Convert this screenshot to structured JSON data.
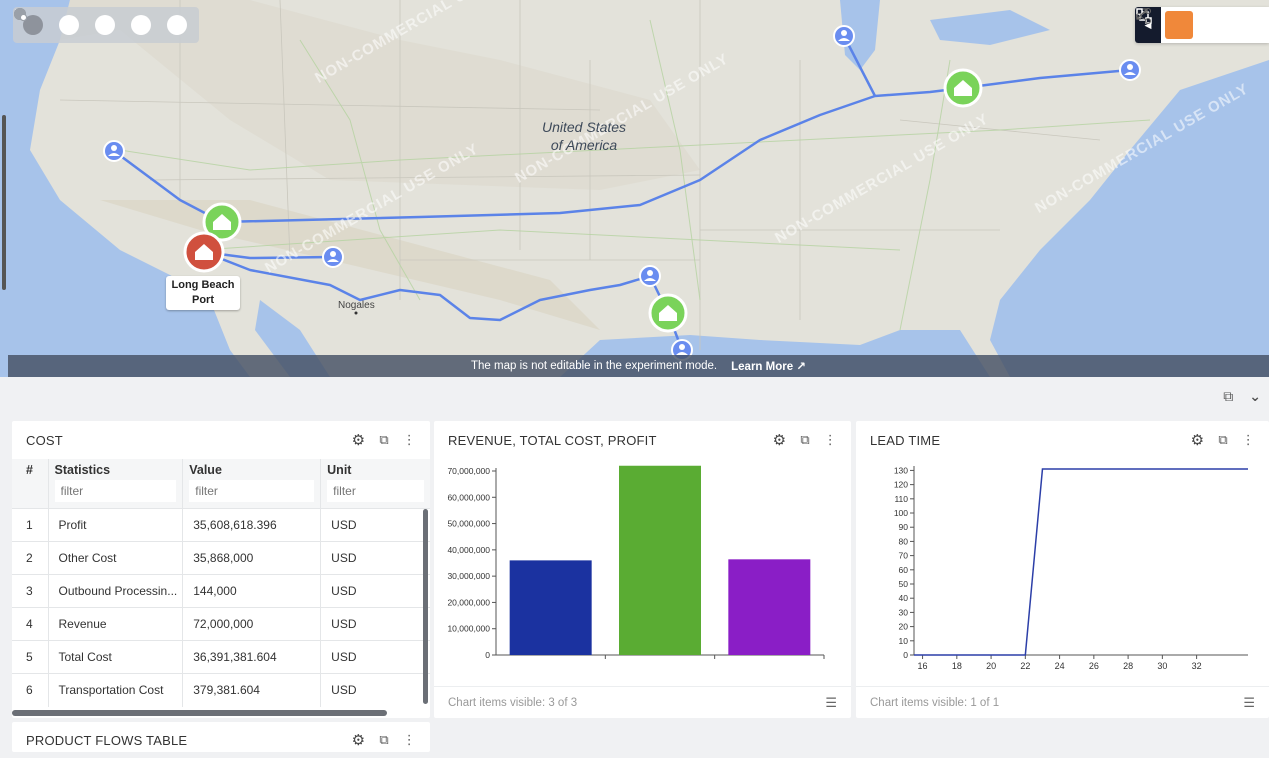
{
  "map": {
    "country_label_line1": "United States",
    "country_label_line2": "of America",
    "city_nogales": "Nogales",
    "pin_label_line1": "Long Beach",
    "pin_label_line2": "Port",
    "banner_text": "The map is not editable in the experiment mode.",
    "learn_more": "Learn More ↗",
    "watermark": "NON-COMMERCIAL USE ONLY",
    "colors": {
      "route": "#5b83e8",
      "warehouse": "#7ad35a",
      "port": "#d0503e",
      "customer": "#6a8df0"
    }
  },
  "panels_toolbar": {
    "expand_icon": "expand-icon",
    "collapse_icon": "chevron-down-icon"
  },
  "cost": {
    "title": "COST",
    "columns": [
      "#",
      "Statistics",
      "Value",
      "Unit"
    ],
    "filter_placeholder": "filter",
    "rows": [
      [
        "1",
        "Profit",
        "35,608,618.396",
        "USD"
      ],
      [
        "2",
        "Other Cost",
        "35,868,000",
        "USD"
      ],
      [
        "3",
        "Outbound Processin...",
        "144,000",
        "USD"
      ],
      [
        "4",
        "Revenue",
        "72,000,000",
        "USD"
      ],
      [
        "5",
        "Total Cost",
        "36,391,381.604",
        "USD"
      ],
      [
        "6",
        "Transportation Cost",
        "379,381.604",
        "USD"
      ]
    ]
  },
  "revenue_chart": {
    "title": "REVENUE, TOTAL COST, PROFIT",
    "footer": "Chart items visible: 3 of 3"
  },
  "lead_time": {
    "title": "LEAD TIME",
    "footer": "Chart items visible: 1 of 1"
  },
  "product_flows": {
    "title": "PRODUCT FLOWS TABLE"
  },
  "chart_data": [
    {
      "type": "bar",
      "title": "REVENUE, TOTAL COST, PROFIT",
      "categories": [
        "",
        "",
        ""
      ],
      "values": [
        36000000,
        72000000,
        36400000
      ],
      "colors": [
        "#1b32a0",
        "#5aac33",
        "#8a1ec6"
      ],
      "ylim": [
        0,
        70000000
      ],
      "yticks": [
        "0",
        "10,000,000",
        "20,000,000",
        "30,000,000",
        "40,000,000",
        "50,000,000",
        "60,000,000",
        "70,000,000"
      ]
    },
    {
      "type": "line",
      "title": "LEAD TIME",
      "x": [
        15.5,
        22,
        23,
        35
      ],
      "y": [
        0,
        0,
        131,
        131
      ],
      "xlim": [
        15.5,
        35
      ],
      "ylim": [
        0,
        131
      ],
      "xticks": [
        "16",
        "18",
        "20",
        "22",
        "24",
        "26",
        "28",
        "30",
        "32"
      ],
      "yticks": [
        "0",
        "10",
        "20",
        "30",
        "40",
        "50",
        "60",
        "70",
        "80",
        "90",
        "100",
        "110",
        "120",
        "130"
      ],
      "color": "#2c3fa8"
    }
  ]
}
